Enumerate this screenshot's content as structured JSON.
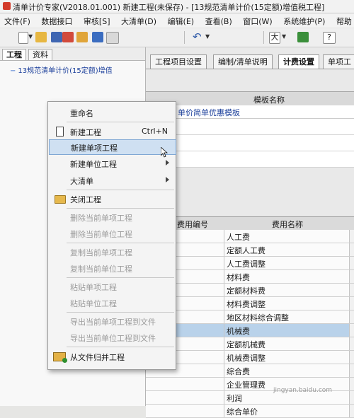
{
  "window": {
    "title": "清单计价专家(V2018.01.001) 新建工程(未保存) - [13规范清单计价(15定额)增值税工程]"
  },
  "menu": [
    "文件(F)",
    "数据接口",
    "审核[S]",
    "大清单(D)",
    "编辑(E)",
    "查看(B)",
    "窗口(W)",
    "系统维护(P)",
    "帮助"
  ],
  "left_panel": {
    "tabs": [
      "工程",
      "资料"
    ],
    "tree_root": "13规范清单计价(15定额)增值"
  },
  "right_panel": {
    "tabs": [
      "工程项目设置",
      "编制/清单说明",
      "计费设置",
      "单项工"
    ],
    "template_header": "模板名称",
    "template_row": "单价简单优惠模板",
    "fee_header": {
      "code": "费用编号",
      "name": "费用名称"
    },
    "fee_rows": [
      "人工费",
      "定额人工费",
      "人工费调整",
      "材料费",
      "定额材料费",
      "材料费调整",
      "地区材料综合调整",
      "机械费",
      "定额机械费",
      "机械费调整",
      "综合费",
      "企业管理费",
      "利润",
      "综合单价"
    ],
    "selected_index": 7
  },
  "context_menu": {
    "items": [
      {
        "label": "重命名",
        "type": "normal"
      },
      {
        "label": "新建工程",
        "shortcut": "Ctrl+N",
        "type": "normal",
        "icon": "document-icon"
      },
      {
        "label": "新建单项工程",
        "type": "highlight"
      },
      {
        "label": "新建单位工程",
        "type": "submenu"
      },
      {
        "label": "大清单",
        "type": "submenu"
      },
      {
        "label": "关闭工程",
        "type": "normal",
        "icon": "folder-icon"
      },
      {
        "label": "删除当前单项工程",
        "type": "disabled"
      },
      {
        "label": "删除当前单位工程",
        "type": "disabled"
      },
      {
        "label": "复制当前单项工程",
        "type": "disabled"
      },
      {
        "label": "复制当前单位工程",
        "type": "disabled"
      },
      {
        "label": "粘贴单项工程",
        "type": "disabled"
      },
      {
        "label": "粘贴单位工程",
        "type": "disabled"
      },
      {
        "label": "导出当前单项工程到文件",
        "type": "disabled"
      },
      {
        "label": "导出当前单位工程到文件",
        "type": "disabled"
      },
      {
        "label": "从文件归并工程",
        "type": "normal",
        "icon": "merge-folder-icon"
      }
    ]
  },
  "watermark": "jingyan.baidu.com"
}
